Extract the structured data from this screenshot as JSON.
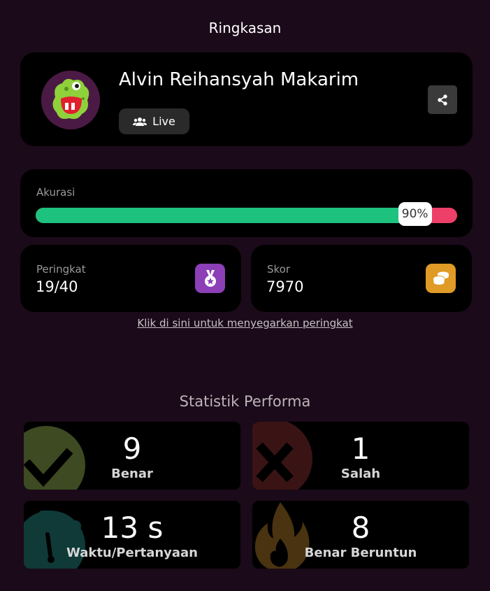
{
  "header": {
    "title": "Ringkasan"
  },
  "profile": {
    "name": "Alvin Reihansyah Makarim",
    "mode_label": "Live"
  },
  "accuracy": {
    "label": "Akurasi",
    "percent": 90,
    "percent_label": "90%",
    "colors": {
      "correct": "#1ec27f",
      "wrong": "#ee3f68"
    }
  },
  "rank": {
    "label": "Peringkat",
    "value": "19/40",
    "icon": "medal-icon",
    "color": "#8c3fb6"
  },
  "score": {
    "label": "Skor",
    "value": "7970",
    "icon": "coins-icon",
    "color": "#e09a26"
  },
  "refresh_link": "Klik di sini untuk menyegarkan peringkat",
  "performance": {
    "title": "Statistik Performa",
    "correct": {
      "value": "9",
      "label": "Benar",
      "icon": "checkmark-icon"
    },
    "wrong": {
      "value": "1",
      "label": "Salah",
      "icon": "cross-icon"
    },
    "time": {
      "value": "13 s",
      "label": "Waktu/Pertanyaan",
      "icon": "stopwatch-icon"
    },
    "streak": {
      "value": "8",
      "label": "Benar Beruntun",
      "icon": "flame-icon"
    }
  }
}
